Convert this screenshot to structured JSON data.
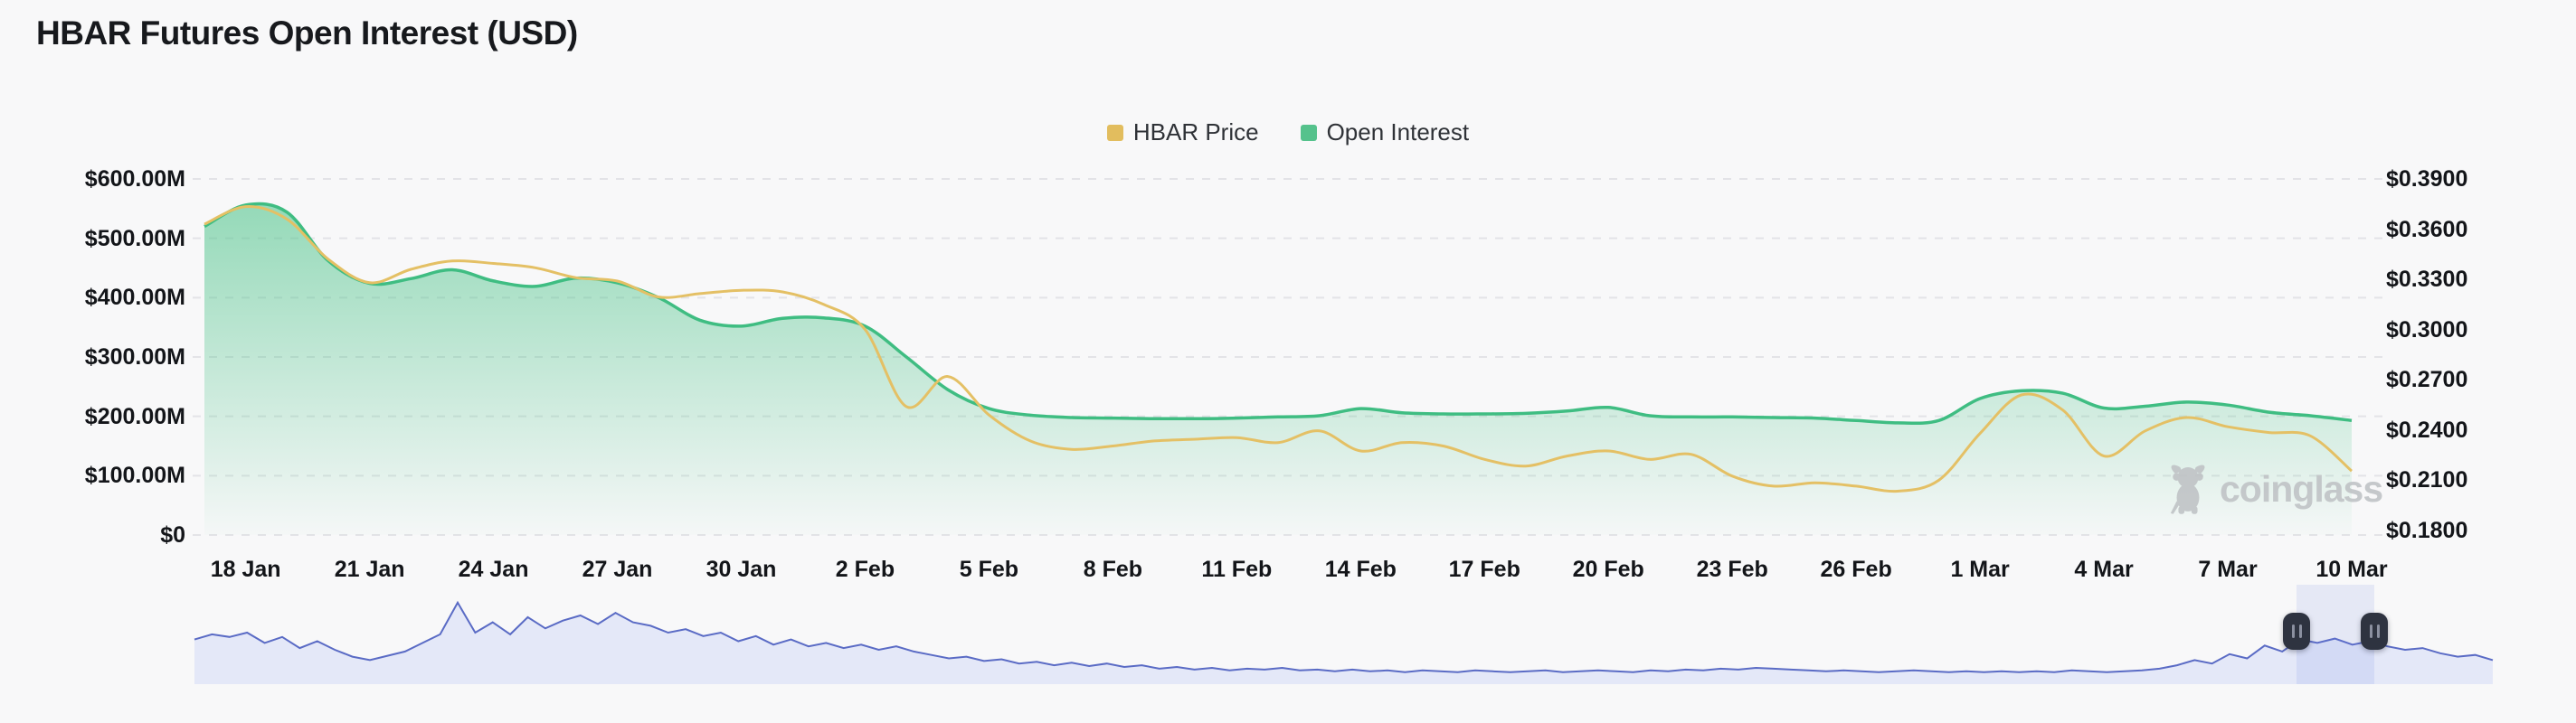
{
  "page": {
    "title": "HBAR Futures Open Interest (USD)"
  },
  "legend": [
    {
      "label": "HBAR Price",
      "color": "#E2BD5E"
    },
    {
      "label": "Open Interest",
      "color": "#55C28C"
    }
  ],
  "watermark": {
    "text": "coinglass"
  },
  "colors": {
    "background": "#F8F8F9",
    "grid": "#E3E3E7",
    "price_line": "#E4C065",
    "oi_line": "#3FBD82",
    "oi_fill_top": "rgba(82,197,141,0.60)",
    "oi_fill_bottom": "rgba(82,197,141,0.02)",
    "nav_line": "#5A6BC5",
    "nav_fill": "#E4E8F8",
    "handle_bg": "#2E3340",
    "handle_bar": "#8B90A0"
  },
  "chart_data": {
    "type": "area",
    "title": "HBAR Futures Open Interest (USD)",
    "legend_position": "top-center",
    "grid": "horizontal-dashed",
    "x_tick_labels": [
      "18 Jan",
      "21 Jan",
      "24 Jan",
      "27 Jan",
      "30 Jan",
      "2 Feb",
      "5 Feb",
      "8 Feb",
      "11 Feb",
      "14 Feb",
      "17 Feb",
      "20 Feb",
      "23 Feb",
      "26 Feb",
      "1 Mar",
      "4 Mar",
      "7 Mar",
      "10 Mar"
    ],
    "left_axis": {
      "ticks": [
        "$600.00M",
        "$500.00M",
        "$400.00M",
        "$300.00M",
        "$200.00M",
        "$100.00M",
        "$0"
      ],
      "min": 0,
      "max": 600,
      "unit": "USD millions"
    },
    "right_axis": {
      "ticks": [
        "$0.3900",
        "$0.3600",
        "$0.3300",
        "$0.3000",
        "$0.2700",
        "$0.2400",
        "$0.2100",
        "$0.1800"
      ],
      "min": 0.18,
      "max": 0.39,
      "unit": "USD"
    },
    "dates": [
      "17 Jan",
      "18 Jan",
      "19 Jan",
      "20 Jan",
      "21 Jan",
      "22 Jan",
      "23 Jan",
      "24 Jan",
      "25 Jan",
      "26 Jan",
      "27 Jan",
      "28 Jan",
      "29 Jan",
      "30 Jan",
      "31 Jan",
      "1 Feb",
      "2 Feb",
      "3 Feb",
      "4 Feb",
      "5 Feb",
      "6 Feb",
      "7 Feb",
      "8 Feb",
      "9 Feb",
      "10 Feb",
      "11 Feb",
      "12 Feb",
      "13 Feb",
      "14 Feb",
      "15 Feb",
      "16 Feb",
      "17 Feb",
      "18 Feb",
      "19 Feb",
      "20 Feb",
      "21 Feb",
      "22 Feb",
      "23 Feb",
      "24 Feb",
      "25 Feb",
      "26 Feb",
      "27 Feb",
      "28 Feb",
      "1 Mar",
      "2 Mar",
      "3 Mar",
      "4 Mar",
      "5 Mar",
      "6 Mar",
      "7 Mar",
      "8 Mar",
      "9 Mar",
      "10 Mar"
    ],
    "series": [
      {
        "name": "Open Interest",
        "type": "area",
        "axis": "left",
        "color": "#3FBD82",
        "values": [
          520,
          556,
          544,
          462,
          424,
          432,
          447,
          428,
          419,
          433,
          425,
          400,
          362,
          352,
          365,
          366,
          352,
          300,
          245,
          213,
          202,
          198,
          197,
          196,
          196,
          197,
          199,
          201,
          213,
          206,
          204,
          204,
          205,
          209,
          215,
          201,
          199,
          199,
          198,
          197,
          193,
          189,
          193,
          230,
          243,
          239,
          214,
          217,
          224,
          219,
          207,
          201,
          193
        ]
      },
      {
        "name": "HBAR Price",
        "type": "line",
        "axis": "right",
        "color": "#E4C065",
        "values": [
          0.363,
          0.3735,
          0.366,
          0.342,
          0.328,
          0.336,
          0.341,
          0.3395,
          0.337,
          0.331,
          0.329,
          0.3195,
          0.3215,
          0.3235,
          0.3225,
          0.315,
          0.3,
          0.254,
          0.272,
          0.249,
          0.2335,
          0.2285,
          0.2305,
          0.2335,
          0.2345,
          0.2355,
          0.2325,
          0.2395,
          0.2275,
          0.2325,
          0.2305,
          0.2225,
          0.2185,
          0.2245,
          0.2275,
          0.2225,
          0.2255,
          0.2125,
          0.2065,
          0.2085,
          0.2065,
          0.2035,
          0.21,
          0.238,
          0.261,
          0.252,
          0.2245,
          0.2395,
          0.2475,
          0.242,
          0.2385,
          0.2365,
          0.2155
        ]
      }
    ]
  },
  "navigator": {
    "description": "range brush mini-chart of open interest history",
    "selection": {
      "from_frac": 0.9146,
      "to_frac": 0.9484
    },
    "values": [
      0.52,
      0.58,
      0.55,
      0.6,
      0.48,
      0.55,
      0.42,
      0.5,
      0.4,
      0.32,
      0.28,
      0.33,
      0.38,
      0.48,
      0.58,
      0.95,
      0.6,
      0.72,
      0.58,
      0.78,
      0.65,
      0.74,
      0.8,
      0.7,
      0.83,
      0.72,
      0.68,
      0.6,
      0.64,
      0.56,
      0.6,
      0.5,
      0.56,
      0.46,
      0.52,
      0.44,
      0.48,
      0.42,
      0.46,
      0.4,
      0.44,
      0.38,
      0.34,
      0.3,
      0.32,
      0.27,
      0.29,
      0.24,
      0.26,
      0.22,
      0.25,
      0.21,
      0.24,
      0.2,
      0.22,
      0.18,
      0.2,
      0.17,
      0.19,
      0.16,
      0.18,
      0.17,
      0.19,
      0.16,
      0.17,
      0.15,
      0.17,
      0.15,
      0.16,
      0.14,
      0.16,
      0.15,
      0.14,
      0.16,
      0.15,
      0.14,
      0.15,
      0.16,
      0.14,
      0.15,
      0.16,
      0.15,
      0.14,
      0.16,
      0.15,
      0.17,
      0.16,
      0.18,
      0.17,
      0.19,
      0.18,
      0.17,
      0.16,
      0.15,
      0.16,
      0.15,
      0.14,
      0.15,
      0.16,
      0.15,
      0.14,
      0.15,
      0.14,
      0.15,
      0.14,
      0.15,
      0.14,
      0.16,
      0.15,
      0.14,
      0.15,
      0.16,
      0.18,
      0.22,
      0.28,
      0.24,
      0.35,
      0.3,
      0.45,
      0.38,
      0.52,
      0.48,
      0.53,
      0.46,
      0.5,
      0.44,
      0.4,
      0.42,
      0.36,
      0.32,
      0.34,
      0.28
    ]
  }
}
